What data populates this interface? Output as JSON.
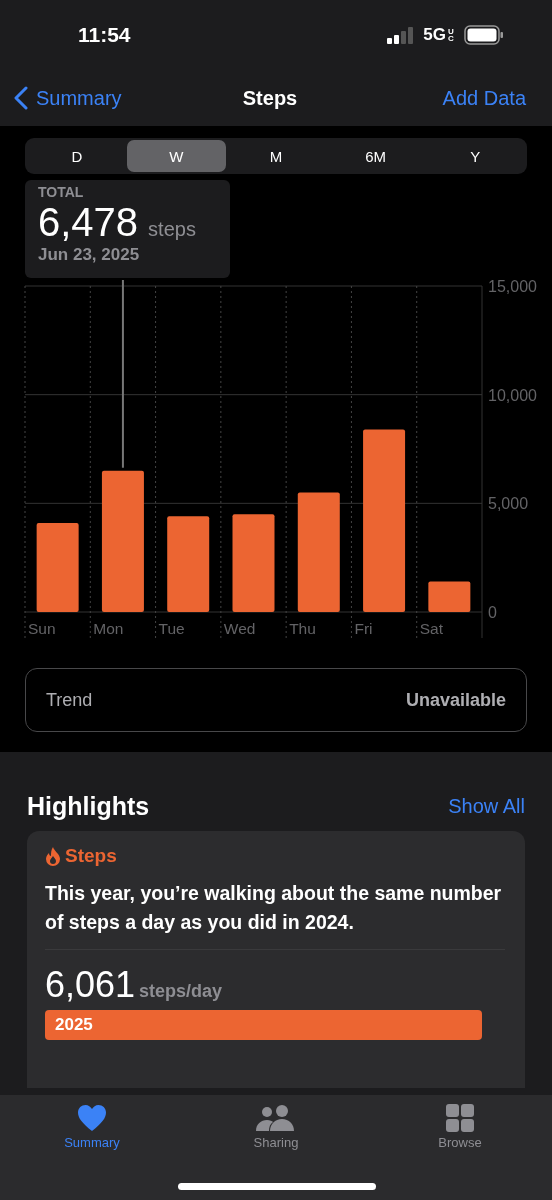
{
  "status_bar": {
    "time": "11:54",
    "network": "5G",
    "network_suffix": "UC"
  },
  "nav": {
    "back": "Summary",
    "title": "Steps",
    "action": "Add Data"
  },
  "ranges": [
    {
      "label": "D",
      "selected": false
    },
    {
      "label": "W",
      "selected": true
    },
    {
      "label": "M",
      "selected": false
    },
    {
      "label": "6M",
      "selected": false
    },
    {
      "label": "Y",
      "selected": false
    }
  ],
  "total": {
    "label": "TOTAL",
    "value": "6,478",
    "unit": "steps",
    "date": "Jun 23, 2025"
  },
  "chart_data": {
    "type": "bar",
    "categories": [
      "Sun",
      "Mon",
      "Tue",
      "Wed",
      "Thu",
      "Fri",
      "Sat"
    ],
    "series": [
      {
        "color": "#ec6532",
        "values": [
          4100,
          6500,
          4400,
          4500,
          5500,
          8400,
          1400
        ]
      }
    ],
    "annotations": [
      {
        "x": "Mon"
      }
    ],
    "ylim": [
      0,
      15000
    ],
    "yticks": [
      {
        "value": 0,
        "label": "0"
      },
      {
        "value": 5000,
        "label": "5,000"
      },
      {
        "value": 10000,
        "label": "10,000"
      },
      {
        "value": 15000,
        "label": "15,000"
      }
    ]
  },
  "trend": {
    "label": "Trend",
    "value": "Unavailable"
  },
  "highlights": {
    "title": "Highlights",
    "action": "Show All",
    "card": {
      "category": "Steps",
      "text": "This year, you’re walking about the same number of steps a day as you did in 2024.",
      "rows": [
        {
          "value": "6,061",
          "unit": "steps/day",
          "bar_label": "2025"
        }
      ]
    }
  },
  "tab_bar": [
    {
      "label": "Summary",
      "selected": true
    },
    {
      "label": "Sharing",
      "selected": false
    },
    {
      "label": "Browse",
      "selected": false
    }
  ]
}
